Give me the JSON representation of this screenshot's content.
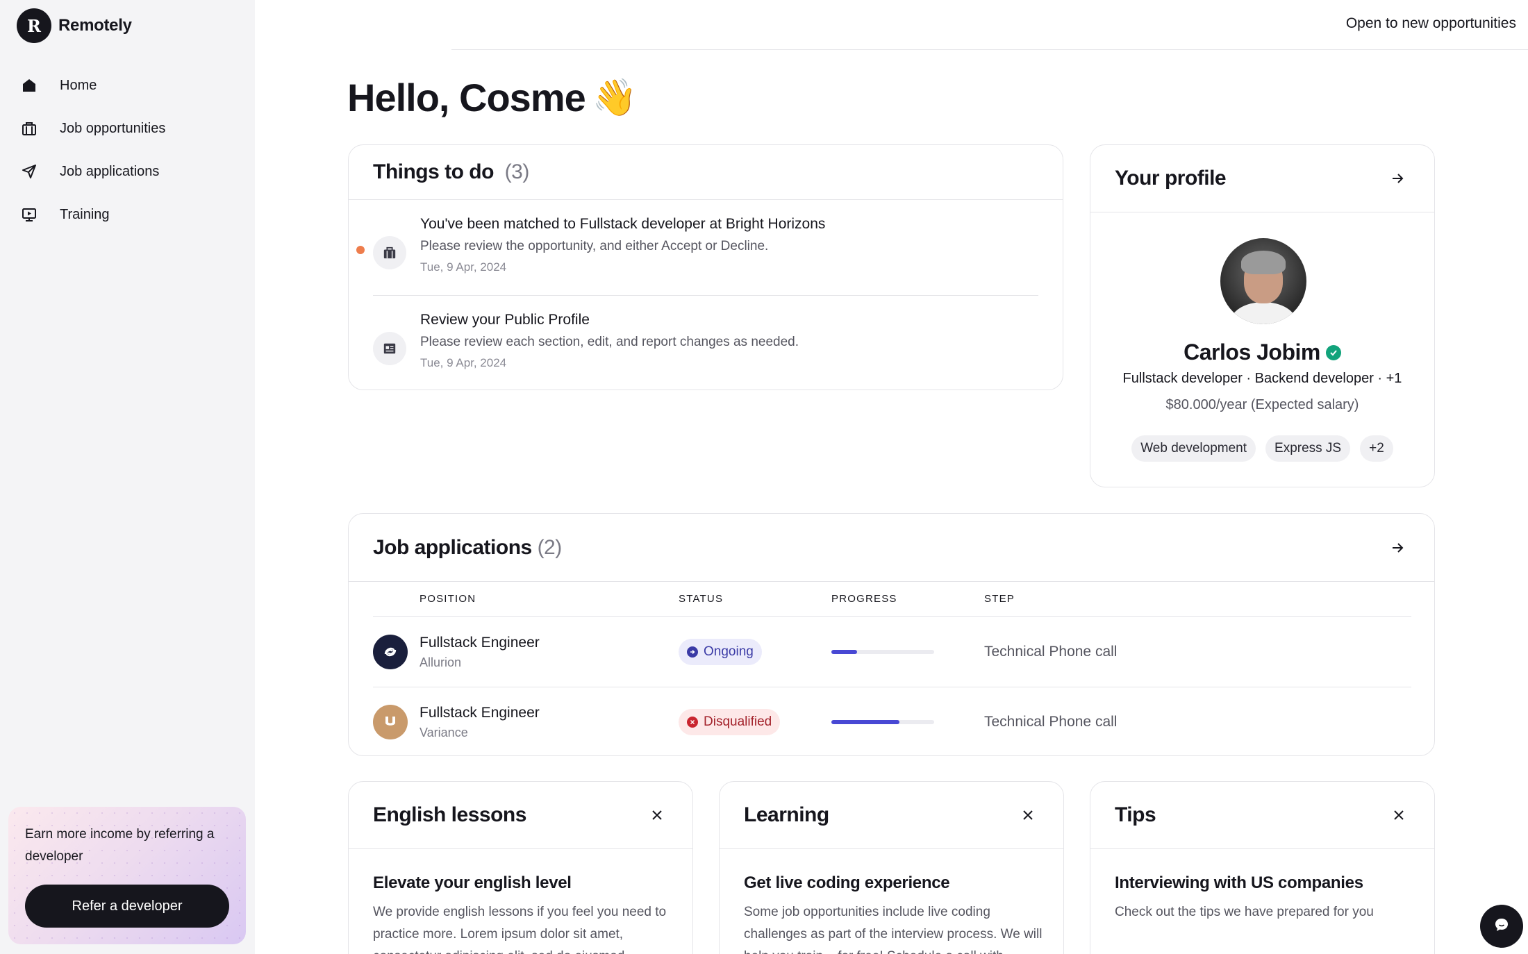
{
  "brand": {
    "name": "Remotely",
    "logo_letter": "R"
  },
  "sidebar": {
    "items": [
      {
        "label": "Home",
        "icon": "home-icon"
      },
      {
        "label": "Job opportunities",
        "icon": "briefcase-icon"
      },
      {
        "label": "Job applications",
        "icon": "send-icon"
      },
      {
        "label": "Training",
        "icon": "monitor-play-icon"
      }
    ],
    "referral": {
      "text": "Earn more income by referring a developer",
      "button": "Refer a developer"
    }
  },
  "topbar": {
    "status": "Open to new opportunities"
  },
  "greeting": {
    "text": "Hello, Cosme",
    "emoji": "👋"
  },
  "todo": {
    "title": "Things to do",
    "count": "(3)",
    "items": [
      {
        "title": "You've been matched to Fullstack developer at Bright Horizons",
        "desc": "Please review the opportunity, and either Accept or Decline.",
        "date": "Tue, 9 Apr, 2024",
        "icon": "briefcase-icon",
        "unread": true
      },
      {
        "title": "Review your Public Profile",
        "desc": "Please review each section, edit, and report changes as needed.",
        "date": "Tue, 9 Apr, 2024",
        "icon": "profile-card-icon",
        "unread": false
      }
    ]
  },
  "profile": {
    "title": "Your profile",
    "name": "Carlos Jobim",
    "roles": "Fullstack developer · Backend developer · +1",
    "salary": "$80.000/year (Expected salary)",
    "tags": [
      "Web development",
      "Express JS",
      "+2"
    ]
  },
  "jobs": {
    "title": "Job applications",
    "count": "(2)",
    "columns": [
      "POSITION",
      "STATUS",
      "PROGRESS",
      "STEP"
    ],
    "rows": [
      {
        "position": "Fullstack Engineer",
        "company": "Allurion",
        "status": "Ongoing",
        "progress": 0.25,
        "step": "Technical Phone call",
        "logo_color": "#1a1f3c"
      },
      {
        "position": "Fullstack Engineer",
        "company": "Variance",
        "status": "Disqualified",
        "progress": 0.66,
        "step": "Technical Phone call",
        "logo_color": "#c99a6b"
      }
    ]
  },
  "cards": [
    {
      "title": "English lessons",
      "subtitle": "Elevate your english level",
      "text": "We provide english lessons if you feel you need to practice more. Lorem ipsum dolor sit amet, consectetur adipiscing elit, sed do eiusmod"
    },
    {
      "title": "Learning",
      "subtitle": "Get live coding experience",
      "text": "Some job opportunities include live coding challenges as part of the interview process. We will help you train... for free! Schedule a call with"
    },
    {
      "title": "Tips",
      "subtitle": "Interviewing with US companies",
      "text": "Check out the tips we have prepared for you"
    }
  ],
  "colors": {
    "accent": "#4848d4",
    "dot": "#ee7d4c",
    "verified": "#12a37b",
    "dark": "#16161d"
  }
}
